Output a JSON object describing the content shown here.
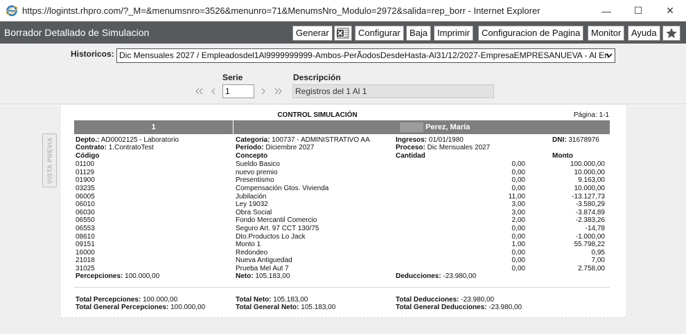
{
  "window": {
    "title": "https://logintst.rhpro.com/?_M=&menumsnro=3526&menunro=71&MenumsNro_Modulo=2972&salida=rep_borr - Internet Explorer",
    "minimize": "—",
    "maximize": "☐",
    "close": "✕"
  },
  "app": {
    "title": "Borrador Detallado de Simulacion",
    "toolbar": {
      "generar": "Generar",
      "configurar": "Configurar",
      "baja": "Baja",
      "imprimir": "Imprimir",
      "config_pagina": "Configuracion de Pagina",
      "monitor": "Monitor",
      "ayuda": "Ayuda"
    }
  },
  "filters": {
    "historicos_label": "Historicos:",
    "historicos_value": "Dic Mensuales 2027 / Empleadosdel1Al9999999999-Ambos-PerÃodosDesdeHasta-Al31/12/2027-EmpresaEMPRESANUEVA - Al En",
    "serie_label": "Serie",
    "serie_value": "1",
    "descripcion_label": "Descripción",
    "descripcion_value": "Registros del 1 Al 1"
  },
  "vista_previa": "VISTA PREVIA",
  "report": {
    "title": "CONTROL SIMULACIÓN",
    "page": "Página: 1-1",
    "employee_number": "1",
    "employee_name": "Perez, María",
    "header": {
      "depto_label": "Depto.:",
      "depto_value": "AD0002125 - Laboratorio",
      "contrato_label": "Contrato:",
      "contrato_value": "1.ContratoTest",
      "categoria_label": "Categoria:",
      "categoria_value": "100737 - ADMINISTRATIVO AA",
      "periodo_label": "Período:",
      "periodo_value": "Diciembre 2027",
      "ingresos_label": "Ingresos:",
      "ingresos_value": "01/01/1980",
      "proceso_label": "Proceso:",
      "proceso_value": "Dic Mensuales 2027",
      "dni_label": "DNI:",
      "dni_value": "31678976"
    },
    "columns": {
      "codigo": "Código",
      "concepto": "Concepto",
      "cantidad": "Cantidad",
      "monto": "Monto"
    },
    "rows": [
      {
        "codigo": "01100",
        "concepto": "Sueldo Basico",
        "cantidad": "0,00",
        "monto": "100.000,00"
      },
      {
        "codigo": "01129",
        "concepto": "nuevo premio",
        "cantidad": "0,00",
        "monto": "10.000,00"
      },
      {
        "codigo": "01900",
        "concepto": "Presentismo",
        "cantidad": "0,00",
        "monto": "9.163,00"
      },
      {
        "codigo": "03235",
        "concepto": "Compensación Gtos. Vivienda",
        "cantidad": "0,00",
        "monto": "10.000,00"
      },
      {
        "codigo": "06005",
        "concepto": "Jubilación",
        "cantidad": "11,00",
        "monto": "-13.127,73"
      },
      {
        "codigo": "06010",
        "concepto": "Ley 19032",
        "cantidad": "3,00",
        "monto": "-3.580,29"
      },
      {
        "codigo": "06030",
        "concepto": "Obra Social",
        "cantidad": "3,00",
        "monto": "-3.874,89"
      },
      {
        "codigo": "06550",
        "concepto": "Fondo Mercantil Comercio",
        "cantidad": "2,00",
        "monto": "-2.383,26"
      },
      {
        "codigo": "06553",
        "concepto": "Seguro Art. 97 CCT 130/75",
        "cantidad": "0,00",
        "monto": "-14,78"
      },
      {
        "codigo": "08610",
        "concepto": "Dto.Productos Lo Jack",
        "cantidad": "0,00",
        "monto": "-1.000,00"
      },
      {
        "codigo": "09151",
        "concepto": "Monto 1",
        "cantidad": "1,00",
        "monto": "55.798,22"
      },
      {
        "codigo": "16000",
        "concepto": "Redondeo",
        "cantidad": "0,00",
        "monto": "0,95"
      },
      {
        "codigo": "21018",
        "concepto": "Nueva Antiguedad",
        "cantidad": "0,00",
        "monto": "7,00"
      },
      {
        "codigo": "31025",
        "concepto": "Prueba Mel Aut 7",
        "cantidad": "0,00",
        "monto": "2.758,00"
      }
    ],
    "summary": {
      "percepciones_label": "Percepciones:",
      "percepciones_value": "100.000,00",
      "neto_label": "Neto:",
      "neto_value": "105.183,00",
      "deducciones_label": "Deducciones:",
      "deducciones_value": "-23.980,00"
    },
    "totals": {
      "total_percepciones_label": "Total Percepciones:",
      "total_percepciones_value": "100.000,00",
      "total_neto_label": "Total Neto:",
      "total_neto_value": "105.183,00",
      "total_deducciones_label": "Total Deducciones:",
      "total_deducciones_value": "-23.980,00",
      "tg_percepciones_label": "Total General Percepciones:",
      "tg_percepciones_value": "100.000,00",
      "tg_neto_label": "Total General Neto:",
      "tg_neto_value": "105.183,00",
      "tg_deducciones_label": "Total General Deducciones:",
      "tg_deducciones_value": "-23.980,00"
    }
  }
}
